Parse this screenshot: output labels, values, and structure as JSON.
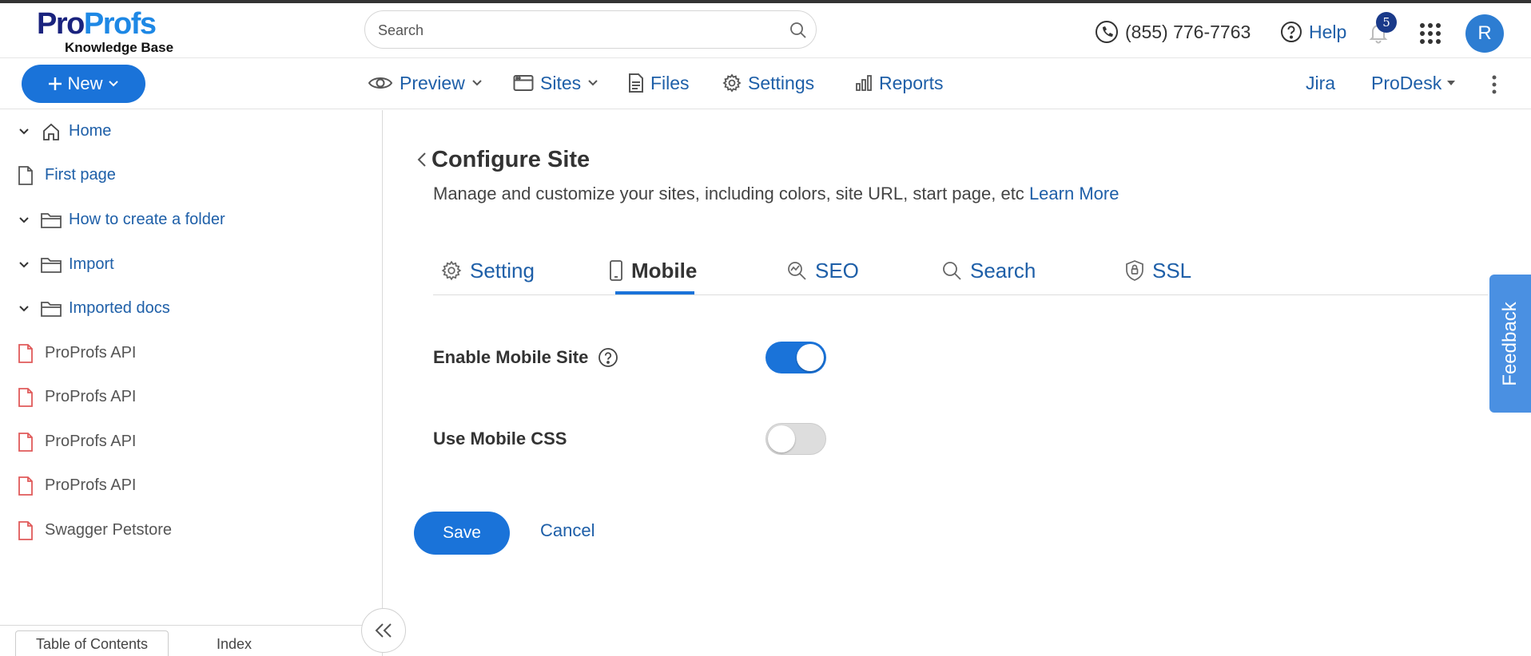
{
  "header": {
    "logo_part1": "Pro",
    "logo_part2": "Profs",
    "logo_sub": "Knowledge Base",
    "search_placeholder": "Search",
    "phone": "(855) 776-7763",
    "help": "Help",
    "notification_count": "5",
    "avatar_initial": "R"
  },
  "toolbar": {
    "new_label": "New",
    "nav": [
      {
        "label": "Preview",
        "icon": "eye-icon"
      },
      {
        "label": "Sites",
        "icon": "browser-icon"
      },
      {
        "label": "Files",
        "icon": "file-icon"
      },
      {
        "label": "Settings",
        "icon": "gear-icon"
      },
      {
        "label": "Reports",
        "icon": "bar-chart-icon"
      }
    ],
    "jira": "Jira",
    "prodesk": "ProDesk"
  },
  "sidebar": {
    "items": [
      {
        "label": "Home",
        "icon": "home-icon"
      },
      {
        "label": "First page",
        "icon": "page-icon"
      },
      {
        "label": "How to create a folder",
        "icon": "folder-icon"
      },
      {
        "label": "Import",
        "icon": "folder-icon"
      },
      {
        "label": "Imported docs",
        "icon": "folder-icon"
      },
      {
        "label": "ProProfs API",
        "icon": "api-page-icon"
      },
      {
        "label": "ProProfs API",
        "icon": "api-page-icon"
      },
      {
        "label": "ProProfs API",
        "icon": "api-page-icon"
      },
      {
        "label": "ProProfs API",
        "icon": "api-page-icon"
      },
      {
        "label": "Swagger Petstore",
        "icon": "api-page-icon"
      }
    ],
    "tabs": [
      "Table of Contents",
      "Index"
    ]
  },
  "main": {
    "title": "Configure Site",
    "description": "Manage and customize your sites, including colors, site URL, start page, etc",
    "learn_more": "Learn More",
    "tabs": [
      {
        "label": "Setting",
        "icon": "gear-icon"
      },
      {
        "label": "Mobile",
        "icon": "mobile-icon"
      },
      {
        "label": "SEO",
        "icon": "seo-icon"
      },
      {
        "label": "Search",
        "icon": "search-icon"
      },
      {
        "label": "SSL",
        "icon": "shield-icon"
      }
    ],
    "active_tab": "Mobile",
    "settings": [
      {
        "label": "Enable Mobile Site",
        "enabled": true
      },
      {
        "label": "Use Mobile CSS",
        "enabled": false
      }
    ],
    "save": "Save",
    "cancel": "Cancel"
  },
  "feedback": "Feedback",
  "colors": {
    "brand_blue": "#1a73d9",
    "link_blue": "#1e5fa8",
    "logo_navy": "#1a237e"
  }
}
